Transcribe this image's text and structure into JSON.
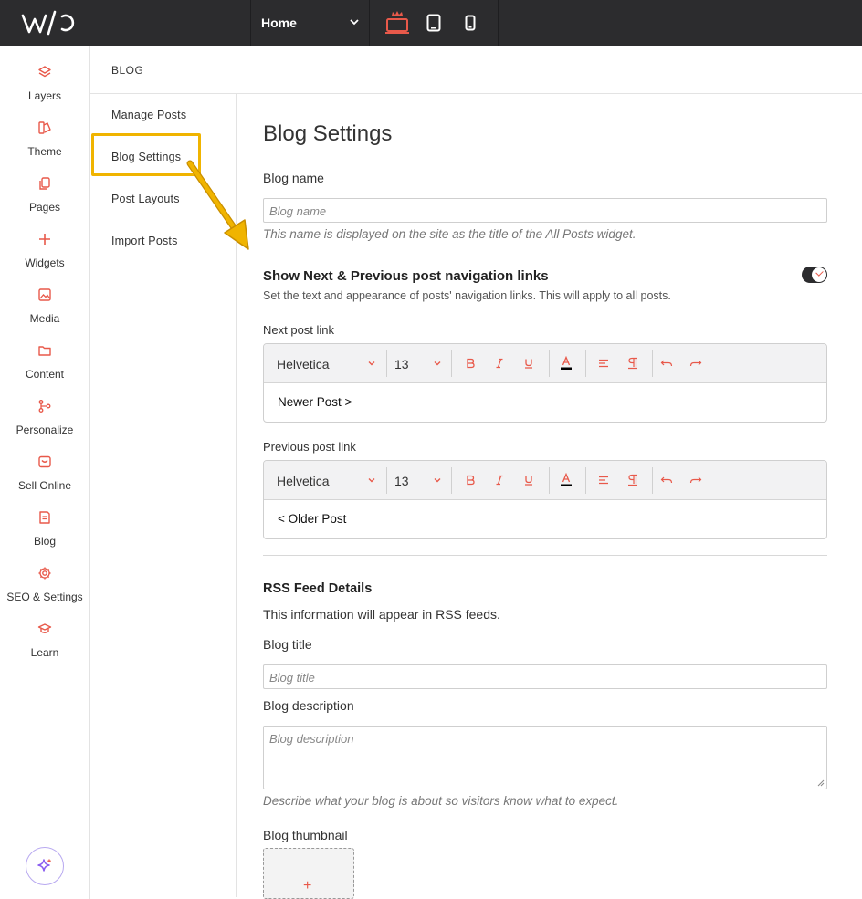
{
  "topbar": {
    "logo_text": "w/o",
    "page_select": "Home",
    "devices": [
      "desktop-icon",
      "tablet-icon",
      "mobile-icon"
    ],
    "accent": "#e8594a"
  },
  "rail": {
    "items": [
      {
        "label": "Layers",
        "icon": "layers-icon"
      },
      {
        "label": "Theme",
        "icon": "theme-icon"
      },
      {
        "label": "Pages",
        "icon": "pages-icon"
      },
      {
        "label": "Widgets",
        "icon": "plus-icon"
      },
      {
        "label": "Media",
        "icon": "image-icon"
      },
      {
        "label": "Content",
        "icon": "folder-icon"
      },
      {
        "label": "Personalize",
        "icon": "personalize-icon"
      },
      {
        "label": "Sell Online",
        "icon": "store-icon"
      },
      {
        "label": "Blog",
        "icon": "blog-icon"
      },
      {
        "label": "SEO & Settings",
        "icon": "gear-icon"
      },
      {
        "label": "Learn",
        "icon": "graduation-cap-icon"
      }
    ]
  },
  "subpanel": {
    "title": "BLOG",
    "items": [
      "Manage Posts",
      "Blog Settings",
      "Post Layouts",
      "Import Posts"
    ]
  },
  "main": {
    "title": "Blog Settings",
    "blog_name_label": "Blog name",
    "blog_name_placeholder": "Blog name",
    "blog_name_hint": "This name is displayed on the site as the title of the All Posts widget.",
    "nav_title": "Show Next & Previous post navigation links",
    "nav_sub": "Set the text and appearance of posts' navigation links. This will apply to all posts.",
    "next_label": "Next post link",
    "prev_label": "Previous post link",
    "editor_font": "Helvetica",
    "editor_size": "13",
    "next_text": "Newer Post >",
    "prev_text": "< Older Post",
    "rss_title": "RSS Feed Details",
    "rss_sub": "This information will appear in RSS feeds.",
    "blog_title_label": "Blog title",
    "blog_title_placeholder": "Blog title",
    "blog_desc_label": "Blog description",
    "blog_desc_placeholder": "Blog description",
    "blog_desc_hint": "Describe what your blog is about so visitors know what to expect.",
    "thumb_label": "Blog thumbnail",
    "thumb_plus": "+"
  }
}
